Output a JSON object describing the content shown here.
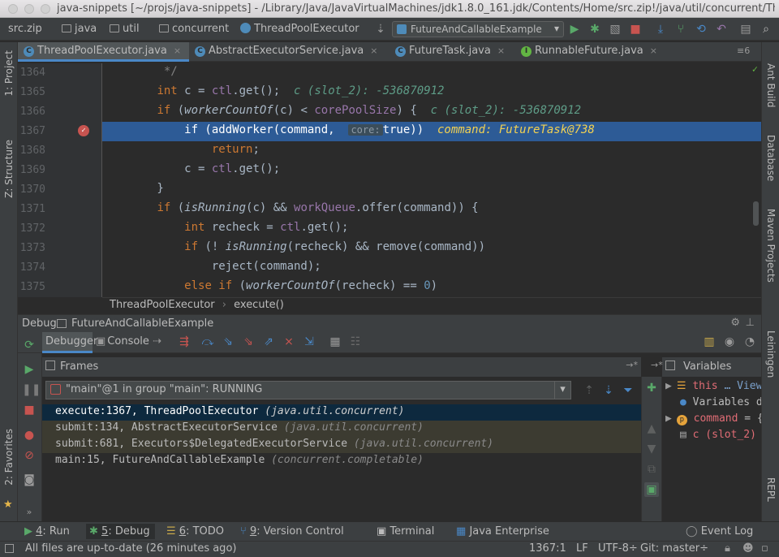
{
  "window": {
    "title": "java-snippets [~/projs/java-snippets] - /Library/Java/JavaVirtualMachines/jdk1.8.0_161.jdk/Contents/Home/src.zip!/java/util/concurrent/Thre…"
  },
  "navbar": {
    "crumbs": [
      "src.zip",
      "java",
      "util",
      "concurrent",
      "ThreadPoolExecutor"
    ],
    "run_config": "FutureAndCallableExample"
  },
  "tabs": [
    {
      "label": "ThreadPoolExecutor.java",
      "icon": "C"
    },
    {
      "label": "AbstractExecutorService.java",
      "icon": "C"
    },
    {
      "label": "FutureTask.java",
      "icon": "C"
    },
    {
      "label": "RunnableFuture.java",
      "icon": "I"
    }
  ],
  "tab_overflow": "≡6",
  "left_strip": {
    "project": "1: Project",
    "structure": "Z: Structure",
    "favorites": "2: Favorites"
  },
  "right_strip": {
    "ant": "Ant Build",
    "database": "Database",
    "maven": "Maven Projects",
    "leiningen": "Leiningen",
    "repl": "REPL"
  },
  "editor": {
    "line_numbers": [
      "1364",
      "1365",
      "1366",
      "1367",
      "1368",
      "1369",
      "1370",
      "1371",
      "1372",
      "1373",
      "1374",
      "1375"
    ],
    "inline_values": {
      "l1365": "c (slot_2): -536870912",
      "l1366": "c (slot_2): -536870912",
      "l1367": "command: FutureTask@738",
      "hint_core": "core:"
    },
    "breadcrumb": [
      "ThreadPoolExecutor",
      "execute()"
    ]
  },
  "debug": {
    "header_label": "Debug",
    "header_config": "FutureAndCallableExample",
    "tab_debugger": "Debugger",
    "tab_console": "Console",
    "frames_label": "Frames",
    "variables_label": "Variables",
    "thread": "\"main\"@1 in group \"main\": RUNNING",
    "frames": [
      {
        "method": "execute:1367, ThreadPoolExecutor",
        "pkg": "(java.util.concurrent)"
      },
      {
        "method": "submit:134, AbstractExecutorService",
        "pkg": "(java.util.concurrent)"
      },
      {
        "method": "submit:681, Executors$DelegatedExecutorService",
        "pkg": "(java.util.concurrent)"
      },
      {
        "method": "main:15, FutureAndCallableExample",
        "pkg": "(concurrent.completable)"
      }
    ],
    "variables": [
      {
        "name": "this",
        "value": "… View"
      },
      {
        "name": "Variables de",
        "value": ""
      },
      {
        "name": "command",
        "value": "= {"
      },
      {
        "name": "c (slot_2)",
        "value": "="
      }
    ]
  },
  "toolwindows": [
    {
      "num": "4",
      "label": ": Run"
    },
    {
      "num": "5",
      "label": ": Debug"
    },
    {
      "num": "6",
      "label": ": TODO"
    },
    {
      "num": "9",
      "label": ": Version Control"
    },
    {
      "num": "",
      "label": "Terminal"
    },
    {
      "num": "",
      "label": "Java Enterprise"
    }
  ],
  "event_log": "Event Log",
  "status": {
    "message": "All files are up-to-date (26 minutes ago)",
    "position": "1367:1",
    "line_sep": "LF",
    "encoding": "UTF-8",
    "git": "Git: master"
  }
}
